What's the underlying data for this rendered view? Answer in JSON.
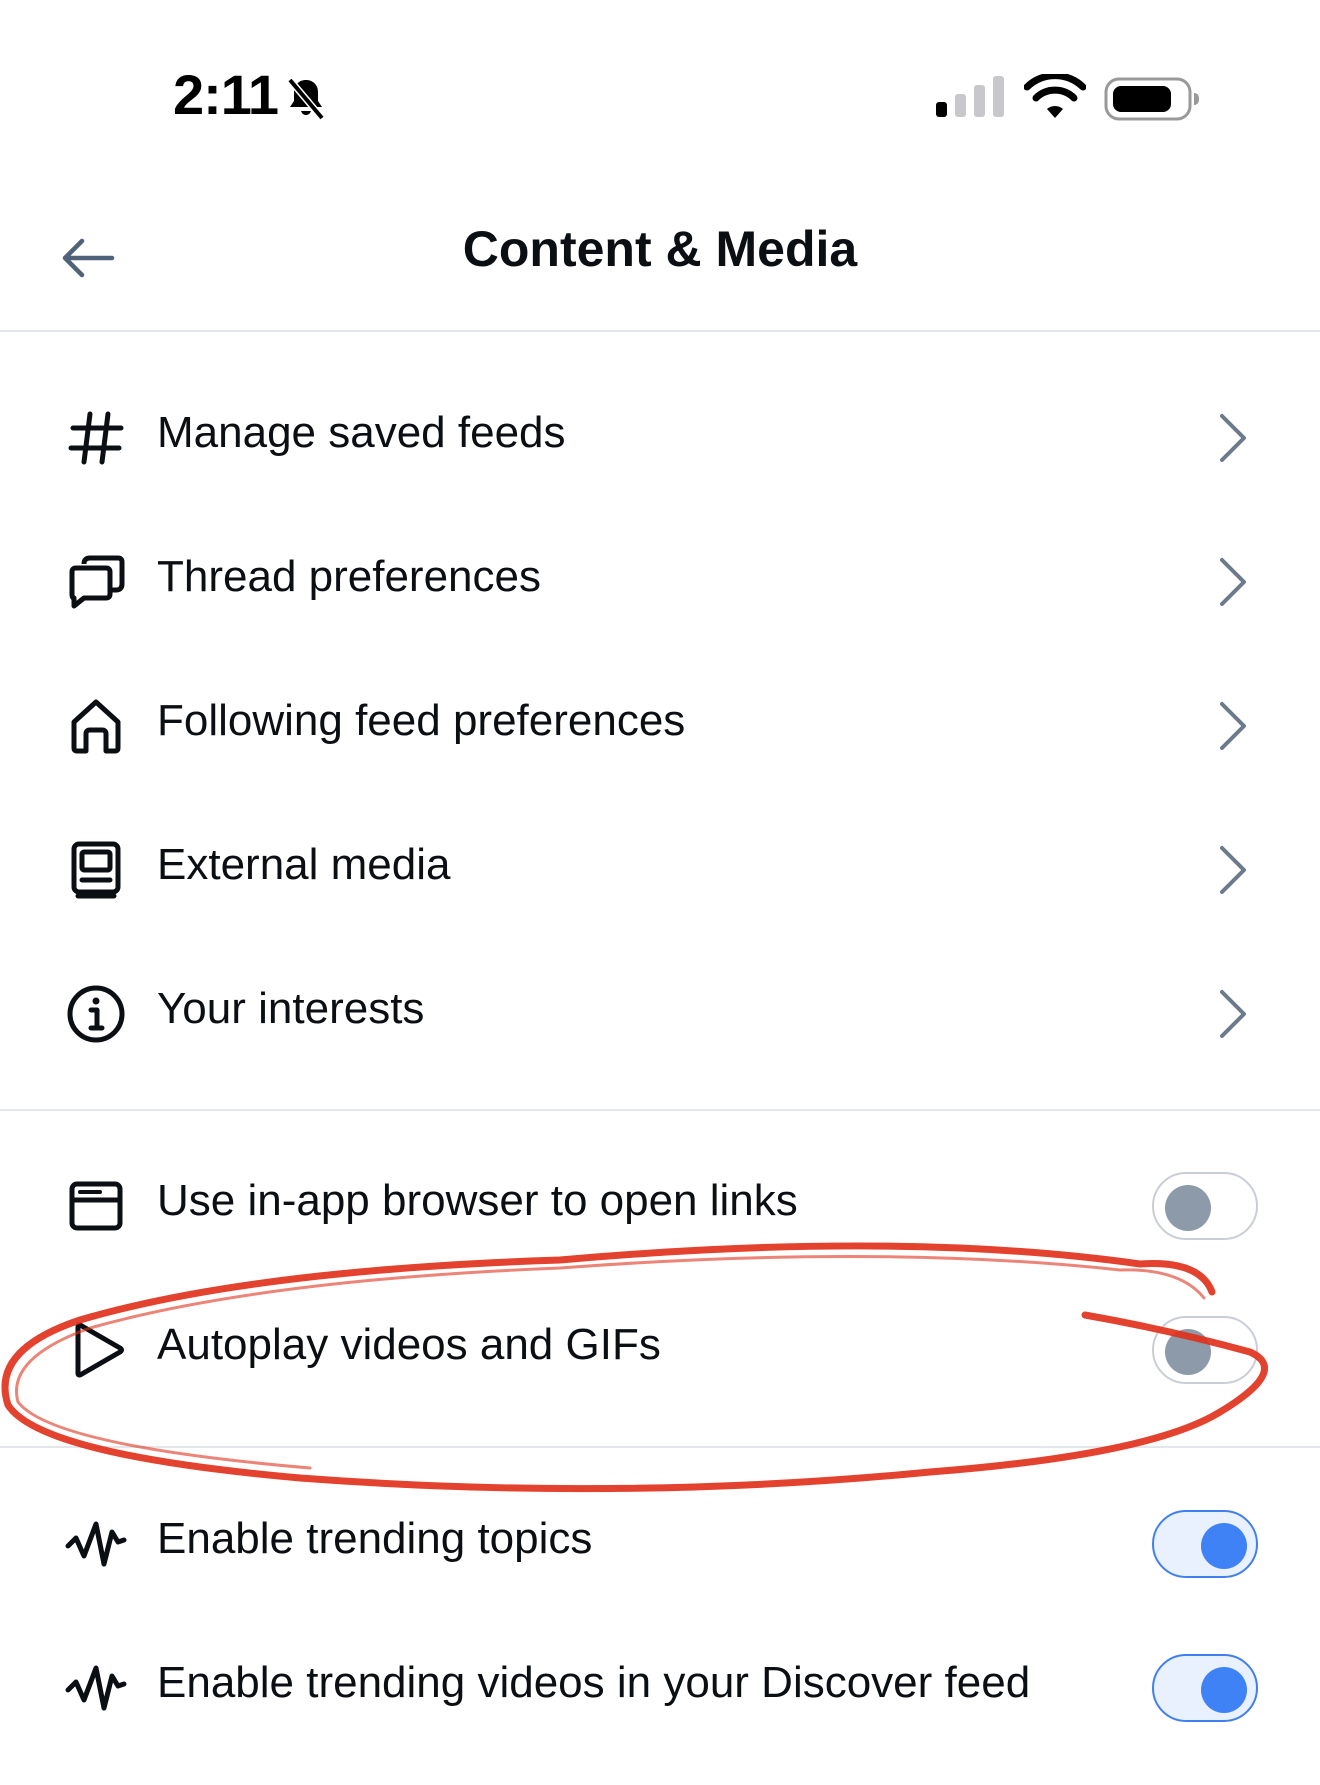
{
  "status_bar": {
    "time": "2:11",
    "icons": [
      "bell-slash-icon",
      "cellular-signal-icon",
      "wifi-icon",
      "battery-icon"
    ]
  },
  "header": {
    "title": "Content & Media",
    "back_icon": "arrow-left-icon"
  },
  "nav_items": [
    {
      "label": "Manage saved feeds",
      "icon": "hashtag-icon"
    },
    {
      "label": "Thread preferences",
      "icon": "chat-bubbles-icon"
    },
    {
      "label": "Following feed preferences",
      "icon": "home-icon"
    },
    {
      "label": "External media",
      "icon": "media-player-icon"
    },
    {
      "label": "Your interests",
      "icon": "info-circle-icon"
    }
  ],
  "toggles": [
    {
      "label": "Use in-app browser to open links",
      "icon": "browser-window-icon",
      "on": false
    },
    {
      "label": "Autoplay videos and GIFs",
      "icon": "play-icon",
      "on": false
    },
    {
      "label": "Enable trending topics",
      "icon": "trending-icon",
      "on": true
    },
    {
      "label": "Enable trending videos in your Discover feed",
      "icon": "trending-icon",
      "on": true
    }
  ],
  "colors": {
    "accent": "#3f82f5",
    "toggle_off_knob": "#8d9aaa",
    "chevron": "#6b7a8c",
    "annotation": "#e0321c"
  }
}
